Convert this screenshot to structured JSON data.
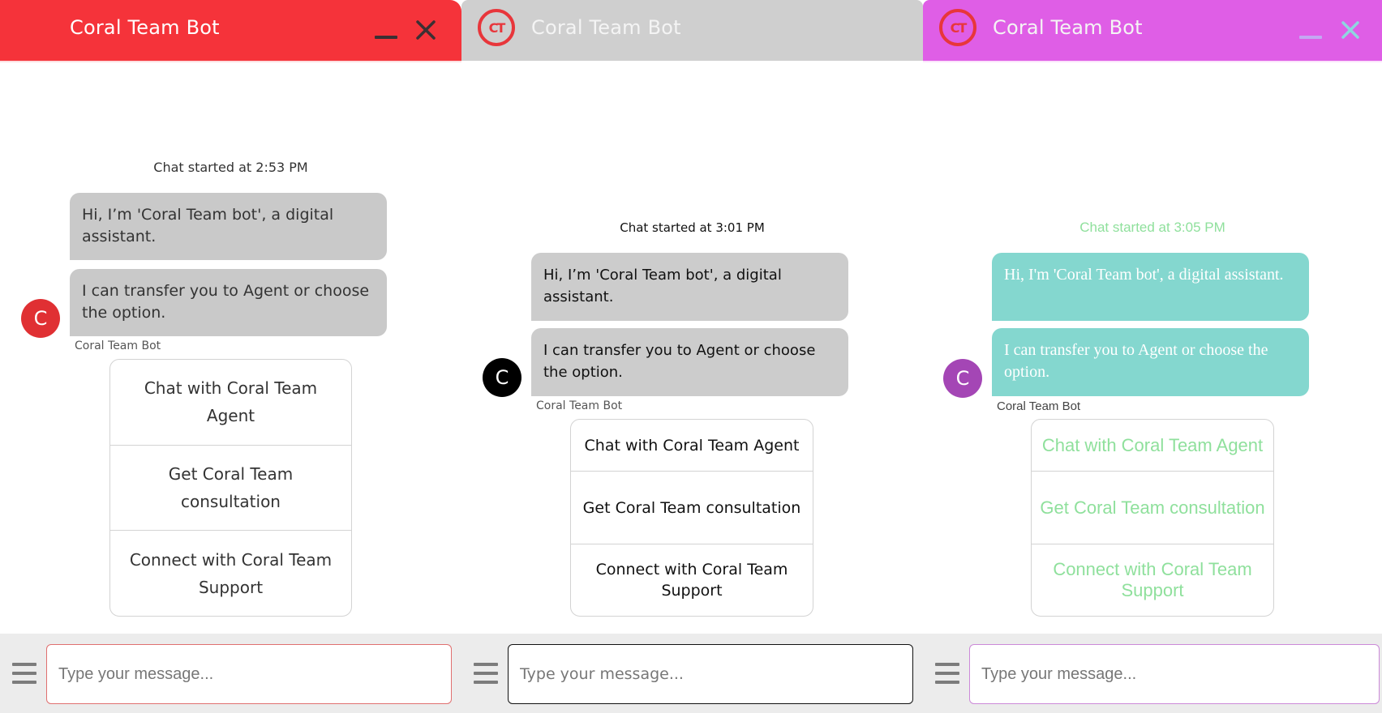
{
  "panels": [
    {
      "theme": "red",
      "colors": {
        "header": "#f5333a",
        "bubble": "#c9c9c9",
        "avatar": "#e03033",
        "input_border": "#e07070"
      },
      "header": {
        "title": "Coral Team Bot",
        "has_logo": false,
        "minimize_icon": "minimize-icon",
        "close_icon": "close-icon"
      },
      "chat_started": "Chat started at 2:53 PM",
      "messages": [
        "Hi, I’m 'Coral Team bot', a digital assistant.",
        "I can transfer you to Agent or choose the option."
      ],
      "avatar_letter": "C",
      "sender_label": "Coral Team Bot",
      "options": [
        "Chat with Coral Team Agent",
        "Get Coral Team consultation",
        "Connect with Coral Team Support"
      ],
      "footer": {
        "menu_icon": "hamburger-menu-icon",
        "input_placeholder": "Type your message...",
        "input_value": ""
      }
    },
    {
      "theme": "gray",
      "colors": {
        "header": "#cfcfcf",
        "bubble": "#cccccc",
        "avatar": "#000000",
        "input_border": "#111111",
        "logo": "#e8363b"
      },
      "header": {
        "title": "Coral Team Bot",
        "has_logo": true,
        "logo_text": "CT"
      },
      "chat_started": "Chat started at 3:01 PM",
      "messages": [
        "Hi, I’m 'Coral Team bot', a digital assistant.",
        "I can transfer you to Agent or choose the option."
      ],
      "avatar_letter": "C",
      "sender_label": "Coral Team Bot",
      "options": [
        "Chat with Coral Team Agent",
        "Get Coral Team consultation",
        "Connect with Coral Team Support"
      ],
      "footer": {
        "menu_icon": "hamburger-menu-icon",
        "input_placeholder": "Type your message...",
        "input_value": ""
      }
    },
    {
      "theme": "purple",
      "colors": {
        "header": "#df5ee6",
        "bubble": "#84d7cf",
        "avatar": "#a446b5",
        "input_border": "#cc8ad8",
        "accent_text": "#8fe09c",
        "logo": "#e8363b"
      },
      "header": {
        "title": "Coral Team Bot",
        "has_logo": true,
        "logo_text": "CT",
        "minimize_icon": "minimize-icon",
        "close_icon": "close-icon"
      },
      "chat_started": "Chat started at 3:05 PM",
      "messages": [
        "Hi, I'm 'Coral Team bot', a digital assistant.",
        "I can transfer you to Agent or choose the option."
      ],
      "avatar_letter": "C",
      "sender_label": "Coral Team Bot",
      "options": [
        "Chat with Coral Team Agent",
        "Get Coral Team consultation",
        "Connect with Coral Team Support"
      ],
      "footer": {
        "menu_icon": "hamburger-menu-icon",
        "input_placeholder": "Type your message...",
        "input_value": ""
      }
    }
  ]
}
